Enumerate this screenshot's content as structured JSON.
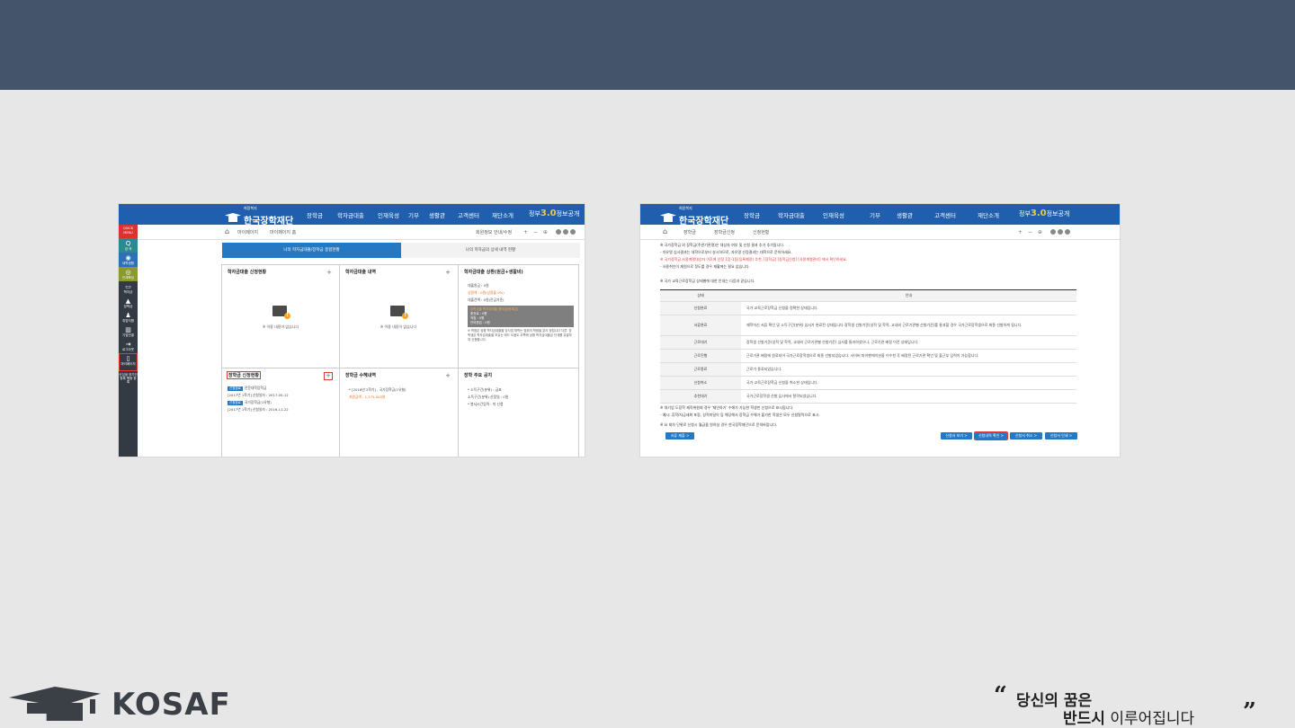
{
  "slide": {
    "footer_brand": "KOSAF",
    "slogan_line1": "당신의 꿈은",
    "slogan_line2_bold": "반드시",
    "slogan_line2_rest": "이루어집니다",
    "quote_open": "“",
    "quote_close": "”"
  },
  "common": {
    "logo_small": "희망복지",
    "logo_name": "한국장학재단",
    "menu": [
      "장학금",
      "학자금대출",
      "인재육성",
      "기부",
      "생활관",
      "고객센터",
      "재단소개"
    ],
    "gov_label": "정부",
    "gov_num": "3.0",
    "gov_tail": "정보공개",
    "home_icon": "⌂",
    "zoom_controls": "+ − ⊕"
  },
  "shot1": {
    "crumb1": "마이페이지",
    "crumb2": "마이페이지 홈",
    "user": "회원정보 안내/수정",
    "quick": "QUICK MENU",
    "side_items": [
      {
        "icon": "Q",
        "label": "검 색"
      },
      {
        "icon": "◉",
        "label": "대학생활"
      },
      {
        "icon": "◎",
        "label": "인재육성"
      },
      {
        "icon": "▭",
        "label": "학자금"
      },
      {
        "icon": "▲",
        "label": "장학금"
      },
      {
        "icon": "♟",
        "label": "취업지원"
      },
      {
        "icon": "▥",
        "label": "기업연결"
      },
      {
        "icon": "⇥",
        "label": "로그아웃"
      },
      {
        "icon": "▯",
        "label": "마이페이지"
      },
      {
        "icon": "",
        "label": "신입생 장기인 등록 행동 등록"
      }
    ],
    "tab_active": "나의 학자금대출/장학금 종합현황",
    "tab_other": "나의 학자금의 상세 내역 현황",
    "cells": {
      "loan_status_title": "학자금대출 신청현황",
      "loan_status_empty": "※ 이용 내용이 없습니다",
      "loan_history_title": "학자금대출 내역",
      "loan_history_empty": "※ 이용 내용이 없습니다",
      "repay_title": "학자금대출 상환(원금+생활비)",
      "repay_lines": [
        "대출원금 : 0원",
        "상환액 : 0원(상환율 0%)",
        "대출잔액 : 0원(잔금기준)"
      ],
      "repay_box_title": "장학금을 학자금대출 원리금(등록금)",
      "repay_box_lines": [
        "충전료 : 0원",
        "적립 : 0원",
        "잔여원금 : 0원"
      ],
      "repay_note": "※ 학점은 상환 학자금대출을 당사업 재학는 범위의 학점을 분리 정립니다 다른. 장학생은 학자금대출을 보유는 레드 도움도 우쪽에 상환 학자금대출금 단계를 유발하여 신청합니다.",
      "sch_status_title": "장학금 신청현황",
      "sch_rows": [
        {
          "badge": "신청완료",
          "name": "전문대학장학금",
          "date": "[2017년 1학기] 신청일자 : 2017-05-12"
        },
        {
          "badge": "신청완료",
          "name": "국가장학금(1유형)",
          "date": "[2017년 1학기] 신청일자 : 2016-11-22"
        }
      ],
      "sch_receive_title": "장학금 수혜내역",
      "sch_receive_lines": [
        "* [2016년 2학기] - 국가장학금(1유형)",
        "지원금액 : 1,575,000원"
      ],
      "sch_notice_title": "장학 주요 공지",
      "sch_notice_lines": [
        "* 소득구간(분위) : 급표",
        "소득구간(분위) 산정일 : 0원",
        "* 봉사시간입력 : 미 신청"
      ]
    }
  },
  "shot2": {
    "crumb1": "장학금",
    "crumb2": "장학금신청",
    "crumb3": "신청현황",
    "notes": [
      {
        "text": "※ 국가장학금 외 장학금(주관기관명)은 대상자 여부 및 신청 결과 추가 추가됩니다.",
        "red": false
      },
      {
        "text": "- 자유명 심사결과는 대학으로부터 실시하므로, 자유명 선정결과는 대학으로 문의하세요.",
        "red": false
      },
      {
        "text": "※ 국가장학금 사용계열대상자 이후에 선정 1등-1등(등록예정) 추천, [장학금] [장학금신청] [사용계열관리] 에서 확인하세요.",
        "red": true
      },
      {
        "text": "- 사용취인이 재원으로 정도를 경우 재활에는 필요 없습니다.",
        "red": false
      }
    ],
    "table_note": "※ 국가 교육근로장학금 상태별에 대한 안내는 다음과 같습니다.",
    "col_state": "상태",
    "col_guide": "안내",
    "rows": [
      {
        "state": "신청완료",
        "guide": "국가 교육근로장학금 신청을 정확한 상태입니다."
      },
      {
        "state": "서류완료",
        "guide": "재학하신 서류 확인 및 소득구간(분위) 심사가 완료된 상태입니다 장학생 선발기준(성적 및 학적, 교내외 근로기관별 선발기준)를 통과할 경우 국가근로장학생으로 최종 선발하게 됩니다."
      },
      {
        "state": "근로대기",
        "guide": "장학생 선발기준(성적 및 학적, 교내외 근로기관별 선발기준) 심사를 통과하였으나, 근로기관 배정 이전 상태입니다."
      },
      {
        "state": "근로진행",
        "guide": "근로기관 배정에 원료되어 국가근로장학생으로 최종 선발되었습니다. 사이버 파이팬에이션을 이수한 후 배정된 근로기관 확인 및 출근부 입력이 가능합니다."
      },
      {
        "state": "근로종료",
        "guide": "근로가 종료되었습니다."
      },
      {
        "state": "신청취소",
        "guide": "국가 교육근로장학금 신청을 취소한 상태입니다."
      },
      {
        "state": "추천대기",
        "guide": "국가근로장학생 선발 심사에서 탈락되었습니다."
      }
    ],
    "bottom_notes": [
      "※ 대기업 도장학 제작위원회 경우 '제인하기' 수해가 가능한 학생만 신청으로 표시됩니다.",
      "- 예시: 휴학/자금세화 포함, 성적미달이 등 해당해서 장학금 수해가 불가한 학생은 모두 신청탈락으로 표시.",
      "※ 요 회차 단위로 신청시 월급을 원하실 경우 한국장학재단으로 문의바랍니다."
    ],
    "btn_left": "서류 제출 >",
    "btn1": "신청서 보기 >",
    "btn2": "신청내역 확인 >",
    "btn3": "신청서 취소 >",
    "btn4": "신청서 인쇄 >"
  }
}
